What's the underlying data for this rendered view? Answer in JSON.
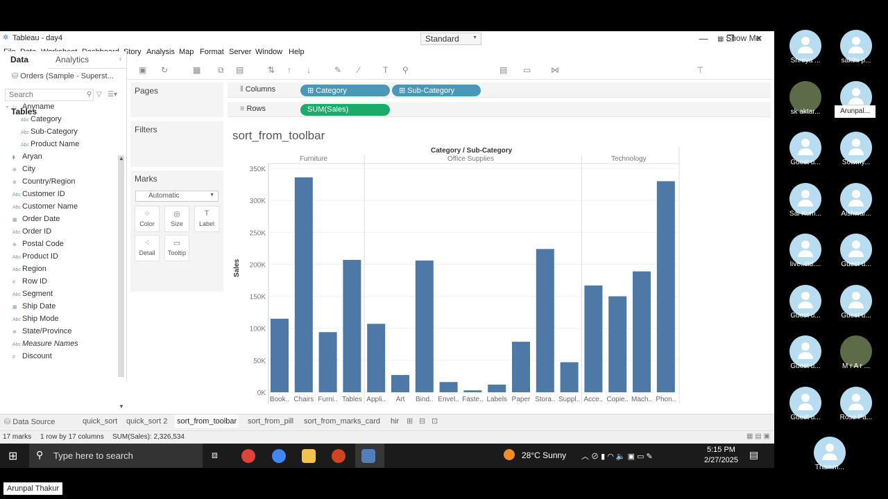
{
  "window": {
    "title": "Tableau - day4"
  },
  "menu": [
    "File",
    "Data",
    "Worksheet",
    "Dashboard",
    "Story",
    "Analysis",
    "Map",
    "Format",
    "Server",
    "Window",
    "Help"
  ],
  "toolbar": {
    "fit": "Standard",
    "show_me": "Show Me"
  },
  "data_pane": {
    "tab_data": "Data",
    "tab_analytics": "Analytics",
    "datasource": "Orders (Sample - Superst...",
    "search_placeholder": "Search",
    "tables_label": "Tables",
    "fields": [
      {
        "label": "Anyname"
      },
      {
        "label": "Category"
      },
      {
        "label": "Sub-Category"
      },
      {
        "label": "Product Name"
      },
      {
        "label": "Aryan"
      },
      {
        "label": "City"
      },
      {
        "label": "Country/Region"
      },
      {
        "label": "Customer ID"
      },
      {
        "label": "Customer Name"
      },
      {
        "label": "Order Date"
      },
      {
        "label": "Order ID"
      },
      {
        "label": "Postal Code"
      },
      {
        "label": "Product ID"
      },
      {
        "label": "Region"
      },
      {
        "label": "Row ID"
      },
      {
        "label": "Segment"
      },
      {
        "label": "Ship Date"
      },
      {
        "label": "Ship Mode"
      },
      {
        "label": "State/Province"
      },
      {
        "label": "Measure Names"
      },
      {
        "label": "Discount"
      }
    ]
  },
  "cards": {
    "pages": "Pages",
    "filters": "Filters",
    "marks": "Marks",
    "mark_type": "Automatic",
    "buttons": [
      "Color",
      "Size",
      "Label",
      "Detail",
      "Tooltip"
    ]
  },
  "shelves": {
    "columns_label": "Columns",
    "rows_label": "Rows",
    "columns": [
      "Category",
      "Sub-Category"
    ],
    "rows": [
      "SUM(Sales)"
    ]
  },
  "sheet_title": "sort_from_toolbar",
  "chart_data": {
    "type": "bar",
    "title": "sort_from_toolbar",
    "header": "Category / Sub-Category",
    "ylabel": "Sales",
    "ylim": [
      0,
      350000
    ],
    "yticks": [
      "0K",
      "50K",
      "100K",
      "150K",
      "200K",
      "250K",
      "300K",
      "350K"
    ],
    "groups": [
      {
        "name": "Furniture",
        "categories": [
          "Book..",
          "Chairs",
          "Furni..",
          "Tables"
        ],
        "values": [
          115000,
          336000,
          94000,
          207000
        ]
      },
      {
        "name": "Office Supplies",
        "categories": [
          "Appli..",
          "Art",
          "Bind..",
          "Envel..",
          "Faste..",
          "Labels",
          "Paper",
          "Stora..",
          "Suppl.."
        ],
        "values": [
          107000,
          27000,
          206000,
          16000,
          3000,
          12000,
          79000,
          224000,
          47000
        ]
      },
      {
        "name": "Technology",
        "categories": [
          "Acce..",
          "Copie..",
          "Mach..",
          "Phon.."
        ],
        "values": [
          167000,
          150000,
          189000,
          330000
        ]
      }
    ],
    "color": "#4e79a7"
  },
  "sheet_tabs": [
    "Data Source",
    "quick_sort",
    "quick_sort 2",
    "sort_from_toolbar",
    "sort_from_pill",
    "sort_from_marks_card",
    "hir"
  ],
  "status": {
    "marks": "17 marks",
    "dims": "1 row by 17 columns",
    "sum": "SUM(Sales): 2,326,534"
  },
  "taskbar": {
    "search": "Type here to search",
    "weather": "28°C  Sunny",
    "time": "5:15 PM",
    "date": "2/27/2025"
  },
  "participants": [
    "Shreya ...",
    "sakthi p...",
    "sk aktar...",
    "Arunpal...",
    "Guest u...",
    "Sowmy...",
    "Sai Kum...",
    "Aishwar...",
    "live..cid....",
    "Guest u...",
    "Guest u...",
    "Guest u...",
    "Guest u...",
    "M r A r ...",
    "Guest u...",
    "Rose Pa...",
    "Thamm..."
  ],
  "current_user": "Arunpal Thakur"
}
